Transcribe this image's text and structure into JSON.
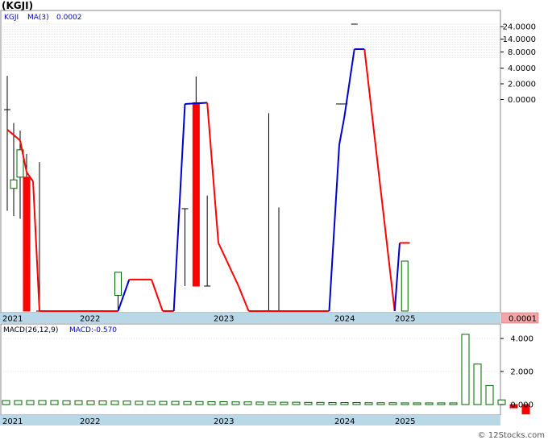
{
  "title": "(KGJI)",
  "watermark": "© 12Stocks.com",
  "colors": {
    "ma_line_low": "#ff0000",
    "ma_line_high": "#0000cc",
    "up_candle": "#006400",
    "down_candle": "#ff0000",
    "axis_band": "#b8d8e8",
    "last_price_box": "#f4a6a6",
    "grid": "#cccccc",
    "legend_text": "#0000cc"
  },
  "chart_data": [
    {
      "type": "candlestick",
      "legend": {
        "symbol": "KGJI",
        "ma_label": "MA(3)",
        "ma_value": "0.0002"
      },
      "x_ticks": [
        "2021",
        "2022",
        "2023",
        "2024",
        "2025"
      ],
      "y_ticks": [
        "24.0000",
        "14.0000",
        "8.0000",
        "4.0000",
        "2.0000",
        "0.0000"
      ],
      "y_scale": "log",
      "last_price": "0.0001",
      "grid": true,
      "ma_series": [
        {
          "x": "2021-01",
          "y": 0.29
        },
        {
          "x": "2021-02",
          "y": 0.23
        },
        {
          "x": "2021-03",
          "y": 0.18
        },
        {
          "x": "2021-04",
          "y": 0.045
        },
        {
          "x": "2021-05",
          "y": 0.03
        },
        {
          "x": "2021-06",
          "y": 0.0001
        },
        {
          "x": "2022-04",
          "y": 0.0001
        },
        {
          "x": "2022-05",
          "y": 0.0004
        },
        {
          "x": "2022-07",
          "y": 0.0004
        },
        {
          "x": "2022-08",
          "y": 0.0001
        },
        {
          "x": "2022-09",
          "y": 0.0001
        },
        {
          "x": "2022-10",
          "y": 0.9
        },
        {
          "x": "2022-12",
          "y": 0.95
        },
        {
          "x": "2023-01",
          "y": 0.002
        },
        {
          "x": "2023-03",
          "y": 0.0003
        },
        {
          "x": "2023-04",
          "y": 0.0001
        },
        {
          "x": "2023-12",
          "y": 0.0001
        },
        {
          "x": "2024-01",
          "y": 0.15
        },
        {
          "x": "2024-02",
          "y": 0.5
        },
        {
          "x": "2024-04",
          "y": 10.0
        },
        {
          "x": "2024-06",
          "y": 10.0
        },
        {
          "x": "2024-12",
          "y": 0.0001
        },
        {
          "x": "2025-01",
          "y": 0.002
        },
        {
          "x": "2025-03",
          "y": 0.002
        }
      ],
      "candles": [
        {
          "x": "2021-01",
          "open": 0.7,
          "high": 3.1,
          "low": 0.0082,
          "close": 0.7
        },
        {
          "x": "2021-02",
          "open": 0.022,
          "high": 0.39,
          "low": 0.0065,
          "close": 0.032
        },
        {
          "x": "2021-03",
          "open": 0.036,
          "high": 0.28,
          "low": 0.0058,
          "close": 0.12
        },
        {
          "x": "2021-04",
          "open": 0.036,
          "high": 0.1,
          "low": 0.0001,
          "close": 0.0001
        },
        {
          "x": "2021-06",
          "open": 0.0001,
          "high": 0.07,
          "low": 0.0001,
          "close": 0.0001
        },
        {
          "x": "2022-04",
          "open": 0.0002,
          "high": 0.00055,
          "low": 0.0001,
          "close": 0.00055
        },
        {
          "x": "2022-10",
          "open": 0.009,
          "high": 0.009,
          "low": 0.0003,
          "close": 0.009
        },
        {
          "x": "2022-11",
          "open": 0.95,
          "high": 3.0,
          "low": 0.0003,
          "close": 0.0003
        },
        {
          "x": "2022-12",
          "open": 0.0003,
          "high": 0.016,
          "low": 0.0003,
          "close": 0.0003
        },
        {
          "x": "2023-06",
          "open": 0.0001,
          "high": 0.6,
          "low": 0.0001,
          "close": 0.0001
        },
        {
          "x": "2023-07",
          "open": 0.0001,
          "high": 0.0095,
          "low": 0.0001,
          "close": 0.0001
        },
        {
          "x": "2024-01",
          "open": 0.9,
          "high": 0.9,
          "low": 0.9,
          "close": 0.9
        },
        {
          "x": "2024-02",
          "open": 0.9,
          "high": 0.9,
          "low": 0.9,
          "close": 0.9
        },
        {
          "x": "2024-04",
          "open": 30.0,
          "high": 30.0,
          "low": 30.0,
          "close": 30.0
        },
        {
          "x": "2025-02",
          "open": 0.0001,
          "high": 0.0009,
          "low": 0.0001,
          "close": 0.0009
        }
      ]
    },
    {
      "type": "bar",
      "legend": {
        "label": "MACD(26,12,9)",
        "value_label": "MACD:-0.570"
      },
      "x_ticks": [
        "2021",
        "2022",
        "2023",
        "2024",
        "2025"
      ],
      "y_ticks": [
        "4.000",
        "2.000",
        "0.000"
      ],
      "ylim": [
        -0.6,
        4.6
      ],
      "grid": true,
      "bars": [
        {
          "x": "2021-01",
          "value": 0.24
        },
        {
          "x": "2021-02",
          "value": 0.24
        },
        {
          "x": "2021-03",
          "value": 0.24
        },
        {
          "x": "2021-04",
          "value": 0.24
        },
        {
          "x": "2021-05",
          "value": 0.24
        },
        {
          "x": "2021-06",
          "value": 0.23
        },
        {
          "x": "2021-07",
          "value": 0.23
        },
        {
          "x": "2021-08",
          "value": 0.22
        },
        {
          "x": "2021-09",
          "value": 0.22
        },
        {
          "x": "2021-10",
          "value": 0.21
        },
        {
          "x": "2021-11",
          "value": 0.21
        },
        {
          "x": "2021-12",
          "value": 0.2
        },
        {
          "x": "2022-01",
          "value": 0.2
        },
        {
          "x": "2022-02",
          "value": 0.19
        },
        {
          "x": "2022-03",
          "value": 0.19
        },
        {
          "x": "2022-04",
          "value": 0.18
        },
        {
          "x": "2022-05",
          "value": 0.18
        },
        {
          "x": "2022-06",
          "value": 0.17
        },
        {
          "x": "2022-07",
          "value": 0.17
        },
        {
          "x": "2022-08",
          "value": 0.16
        },
        {
          "x": "2022-09",
          "value": 0.16
        },
        {
          "x": "2022-10",
          "value": 0.15
        },
        {
          "x": "2022-11",
          "value": 0.15
        },
        {
          "x": "2022-12",
          "value": 0.14
        },
        {
          "x": "2023-01",
          "value": 0.14
        },
        {
          "x": "2023-02",
          "value": 0.13
        },
        {
          "x": "2023-03",
          "value": 0.13
        },
        {
          "x": "2023-04",
          "value": 0.12
        },
        {
          "x": "2023-05",
          "value": 0.12
        },
        {
          "x": "2023-06",
          "value": 0.12
        },
        {
          "x": "2023-07",
          "value": 0.11
        },
        {
          "x": "2023-08",
          "value": 0.11
        },
        {
          "x": "2023-09",
          "value": 0.11
        },
        {
          "x": "2023-10",
          "value": 0.1
        },
        {
          "x": "2023-11",
          "value": 0.1
        },
        {
          "x": "2023-12",
          "value": 0.1
        },
        {
          "x": "2024-01",
          "value": 0.1
        },
        {
          "x": "2024-02",
          "value": 0.1
        },
        {
          "x": "2024-03",
          "value": 4.25
        },
        {
          "x": "2024-04",
          "value": 2.45
        },
        {
          "x": "2024-05",
          "value": 1.15
        },
        {
          "x": "2024-06",
          "value": 0.28
        },
        {
          "x": "2024-07",
          "value": -0.2
        },
        {
          "x": "2024-08",
          "value": -0.57
        }
      ]
    }
  ]
}
